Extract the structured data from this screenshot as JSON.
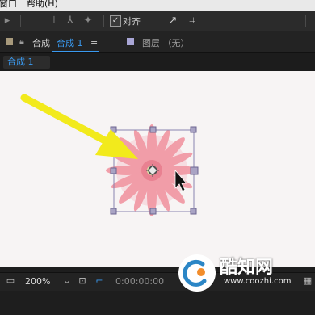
{
  "menubar": {
    "items": [
      "窗口",
      "帮助(H)"
    ]
  },
  "toolbar": {
    "align_label": "对齐",
    "align_checked": true
  },
  "tabs": {
    "comp_panel_prefix": "合成",
    "comp_panel_name": "合成 1",
    "menu_glyph": "≡",
    "layer_panel_label": "图层 （无）",
    "comp_swatch": "#a89a7c",
    "layer_swatch": "#a9a6d6"
  },
  "subtab": {
    "label": "合成 1"
  },
  "footer": {
    "zoom": "200%",
    "timecode": "0:00:00:00"
  },
  "colors": {
    "accent": "#3a9af0",
    "arrow": "#f2ea1c",
    "flower": "#f19aa6",
    "canvas_bg": "#f7f4f4"
  },
  "watermark": {
    "title": "酷知网",
    "url": "www.coozhi.com"
  }
}
